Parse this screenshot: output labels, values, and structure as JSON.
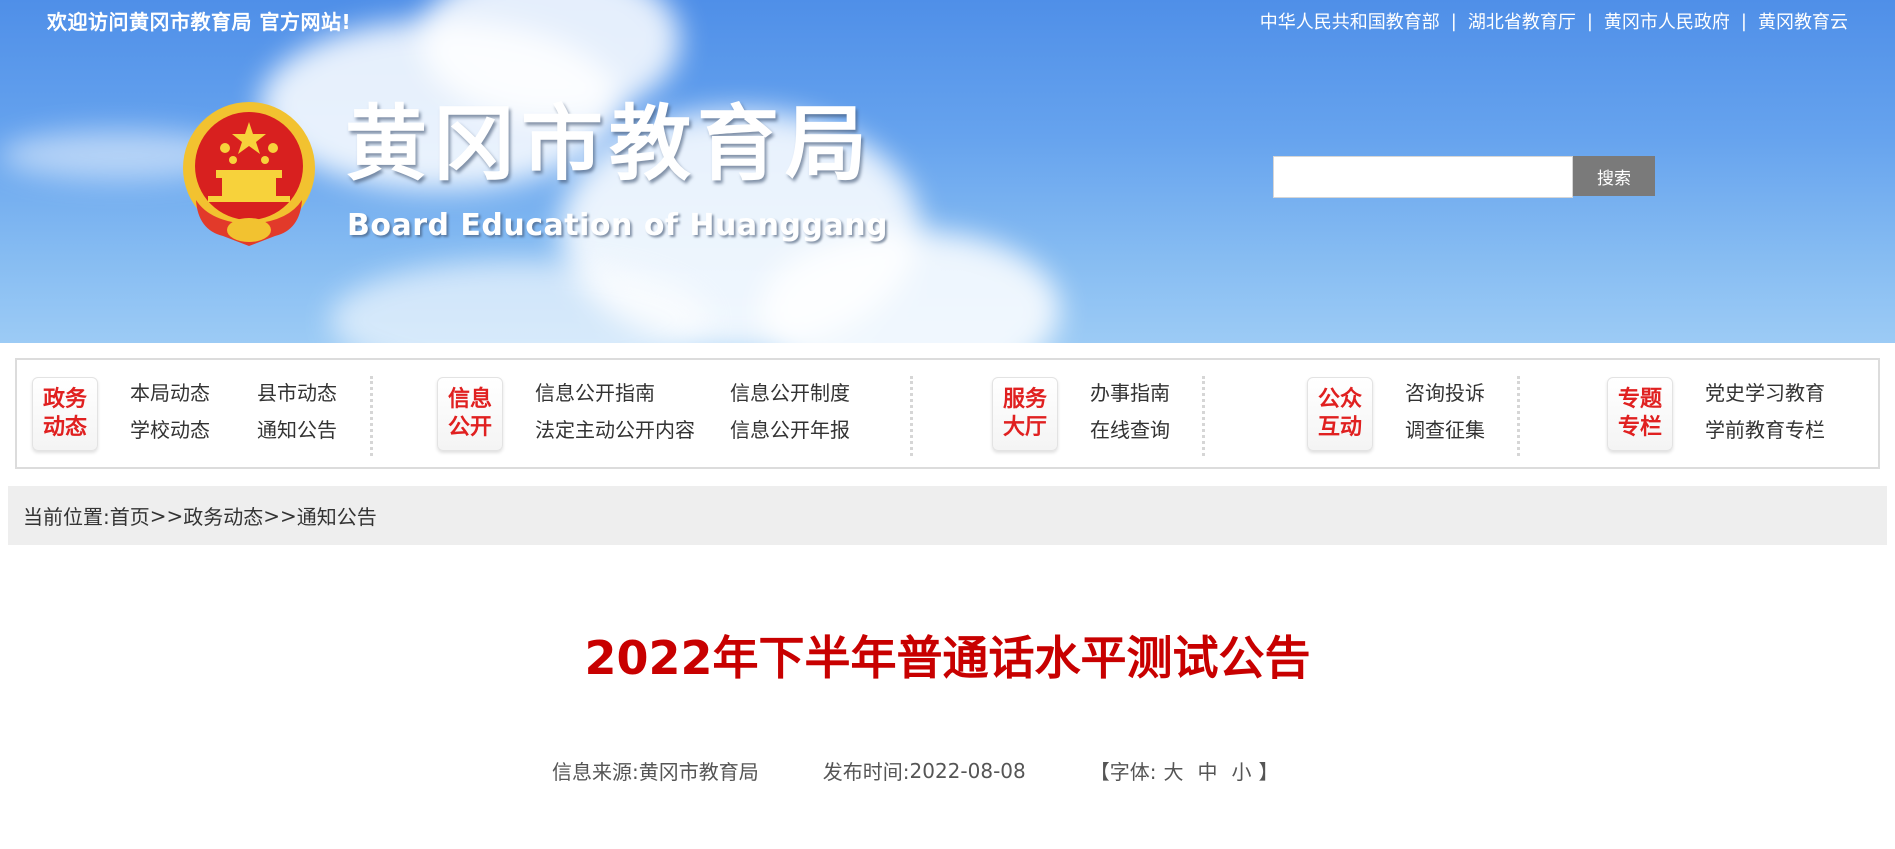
{
  "header": {
    "welcome": "欢迎访问黄冈市教育局 官方网站!",
    "top_links": [
      "中华人民共和国教育部",
      "湖北省教育厅",
      "黄冈市人民政府",
      "黄冈教育云"
    ],
    "separator": "|",
    "title": "黄冈市教育局",
    "subtitle": "Board Education of Huanggang",
    "search": {
      "placeholder": "",
      "value": "",
      "button": "搜索"
    }
  },
  "nav": [
    {
      "icon": [
        "政务",
        "动态"
      ],
      "links": [
        "本局动态",
        "学校动态",
        "县市动态",
        "通知公告"
      ]
    },
    {
      "icon": [
        "信息",
        "公开"
      ],
      "links": [
        "信息公开指南",
        "法定主动公开内容",
        "信息公开制度",
        "信息公开年报"
      ]
    },
    {
      "icon": [
        "服务",
        "大厅"
      ],
      "links": [
        "办事指南",
        "在线查询"
      ]
    },
    {
      "icon": [
        "公众",
        "互动"
      ],
      "links": [
        "咨询投诉",
        "调查征集"
      ]
    },
    {
      "icon": [
        "专题",
        "专栏"
      ],
      "links": [
        "党史学习教育",
        "学前教育专栏"
      ]
    }
  ],
  "breadcrumb": {
    "label": "当前位置:",
    "items": [
      "首页",
      "政务动态",
      "通知公告"
    ],
    "separator": ">>"
  },
  "article": {
    "title": "2022年下半年普通话水平测试公告",
    "source_label": "信息来源:",
    "source": "黄冈市教育局",
    "date_label": "发布时间:",
    "date": "2022-08-08",
    "font_open": "【字体:",
    "font_large": "大",
    "font_medium": "中",
    "font_small": "小",
    "font_close": "】"
  },
  "colors": {
    "title_red": "#c80000",
    "icon_red": "#e02020",
    "search_button": "#7a7a7a"
  }
}
